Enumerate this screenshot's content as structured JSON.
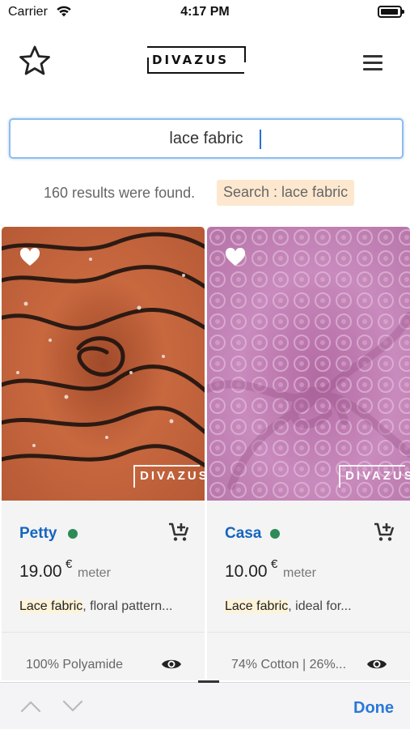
{
  "status_bar": {
    "carrier": "Carrier",
    "time": "4:17 PM",
    "wifi_icon": "wifi-icon",
    "battery_icon": "battery-icon"
  },
  "header": {
    "favorite_icon": "star-outline-icon",
    "logo_text": "DIVAZUS",
    "menu_icon": "hamburger-menu-icon"
  },
  "search": {
    "value": "lace fabric",
    "placeholder": ""
  },
  "results": {
    "count_text": "160 results were found.",
    "tag_text": "Search : lace fabric"
  },
  "products": [
    {
      "name": "Petty",
      "price": "19.00",
      "currency": "€",
      "unit": "meter",
      "desc_highlight": "Lace fabric",
      "desc_rest": ", floral pattern...",
      "material": "100% Polyamide",
      "watermark": "DIVAZUS",
      "stock_color": "#2e8b57"
    },
    {
      "name": "Casa",
      "price": "10.00",
      "currency": "€",
      "unit": "meter",
      "desc_highlight": "Lace fabric",
      "desc_rest": ", ideal for...",
      "material": "74% Cotton | 26%...",
      "watermark": "DIVAZUS",
      "stock_color": "#2e8b57"
    }
  ],
  "toolbar": {
    "done_label": "Done",
    "prev_icon": "chevron-up-icon",
    "next_icon": "chevron-down-icon"
  },
  "colors": {
    "accent": "#1565c0",
    "done": "#2979d8",
    "tag_bg": "#fde8cf",
    "search_border": "#8dbdf0"
  }
}
